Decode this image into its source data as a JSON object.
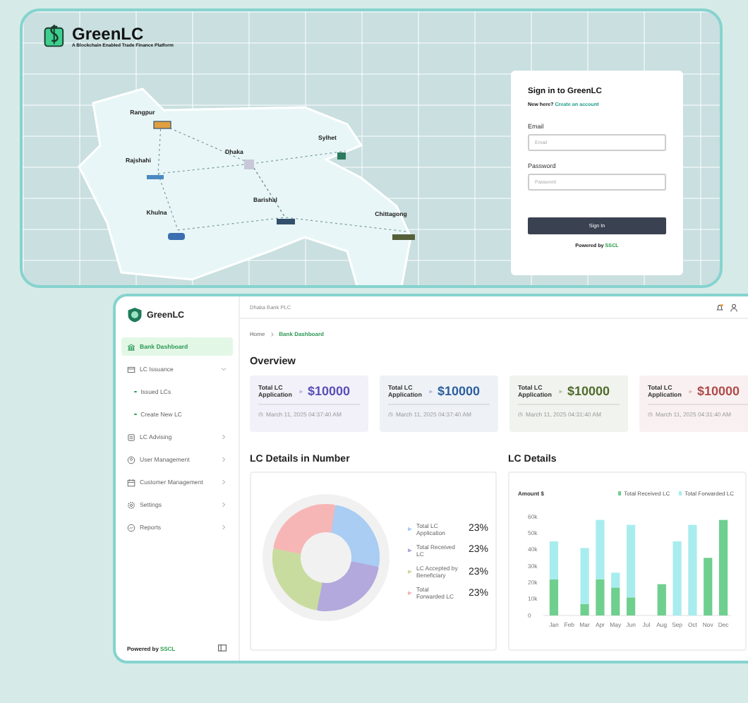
{
  "login_screen": {
    "logo": {
      "name": "GreenLC",
      "tagline": "A Blockchain Enabled Trade Finance Platform"
    },
    "map_cities": [
      "Rangpur",
      "Rajshahi",
      "Dhaka",
      "Sylhet",
      "Khulna",
      "Barishal",
      "Chittagong"
    ],
    "sign_in": {
      "title": "Sign in to GreenLC",
      "prompt": "New here?",
      "link": "Create an account",
      "fields": [
        {
          "label": "Email",
          "placeholder": "Email"
        },
        {
          "label": "Password",
          "placeholder": "Password"
        }
      ],
      "button": "Sign In",
      "footer": "Powered by",
      "footer_brand": "SSCL"
    }
  },
  "dashboard": {
    "logo": "GreenLC",
    "bank": "Dhaka Bank PLC",
    "sidebar": {
      "items": [
        {
          "label": "Bank Dashboard",
          "selected": true
        },
        {
          "label": "LC Issuance",
          "selected": false,
          "expanded": true,
          "children": [
            {
              "label": "Issued LCs",
              "selected": false
            },
            {
              "label": "Create New LC",
              "selected": false
            }
          ]
        },
        {
          "label": "LC Advising",
          "selected": false,
          "expanded": false
        },
        {
          "label": "User Management",
          "selected": false,
          "expanded": false
        },
        {
          "label": "Customer Management",
          "selected": false,
          "expanded": false
        },
        {
          "label": "Settings",
          "selected": false,
          "expanded": false
        },
        {
          "label": "Reports",
          "selected": false,
          "expanded": false
        }
      ],
      "footer": "Powered by",
      "footer_brand": "SSCL"
    },
    "breadcrumb": [
      "Home",
      "Bank Dashboard"
    ],
    "overview_title": "Overview",
    "cards": [
      {
        "label": "Total LC Application",
        "amount": "$10000",
        "date": "March 11, 2025 04:37:40 AM",
        "color": "#5a4fb8"
      },
      {
        "label": "Total LC Application",
        "amount": "$10000",
        "date": "March 11, 2025 04:37:40 AM",
        "color": "#2d5f9e"
      },
      {
        "label": "Total LC Application",
        "amount": "$10000",
        "date": "March 11, 2025 04:31:40 AM",
        "color": "#4f6b2c"
      },
      {
        "label": "Total LC Application",
        "amount": "$10000",
        "date": "March 11, 2025 04:31:40 AM",
        "color": "#b04a4a"
      }
    ],
    "donut_panel": {
      "title": "LC Details in Number",
      "legend": [
        {
          "label": "Total LC Application",
          "value": "23%",
          "color": "#a9cdf3"
        },
        {
          "label": "Total Received LC",
          "value": "23%",
          "color": "#b3a9dc"
        },
        {
          "label": "LC Accepted by Beneficiary",
          "value": "23%",
          "color": "#c9dc9f"
        },
        {
          "label": "Total Forwarded LC",
          "value": "23%",
          "color": "#f7b6b6"
        }
      ]
    },
    "bar_panel": {
      "title": "LC Details",
      "chart_data": {
        "type": "bar",
        "ylabel": "Amount $",
        "categories": [
          "Jan",
          "Feb",
          "Mar",
          "Apr",
          "May",
          "Jun",
          "Jul",
          "Aug",
          "Sep",
          "Oct",
          "Nov",
          "Dec"
        ],
        "stacked": true,
        "ylim": [
          0,
          60000
        ],
        "yticks": [
          {
            "value": 0,
            "label": "0"
          },
          {
            "value": 10000,
            "label": "10k"
          },
          {
            "value": 20000,
            "label": "20k"
          },
          {
            "value": 30000,
            "label": "30k"
          },
          {
            "value": 40000,
            "label": "40k"
          },
          {
            "value": 50000,
            "label": "50k"
          },
          {
            "value": 60000,
            "label": "60k"
          }
        ],
        "series": [
          {
            "name": "Total Received LC",
            "color": "#6fcf8f",
            "values": [
              22000,
              null,
              7000,
              22000,
              17000,
              11000,
              null,
              19000,
              null,
              null,
              35000,
              58000
            ]
          },
          {
            "name": "Total Forwarded LC",
            "color": "#a8ecee",
            "values": [
              23000,
              null,
              34000,
              36000,
              9000,
              44000,
              null,
              null,
              45000,
              55000,
              null,
              null
            ]
          }
        ]
      }
    }
  }
}
